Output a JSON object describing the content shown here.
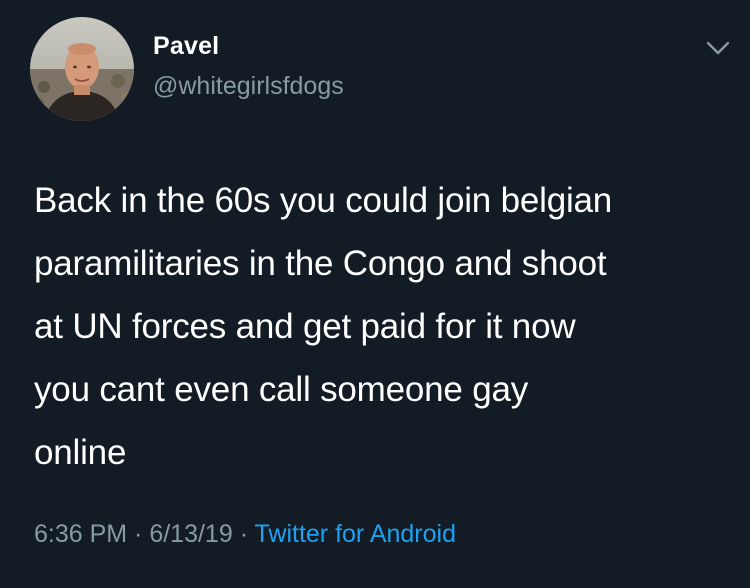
{
  "user": {
    "display_name": "Pavel",
    "handle": "@whitegirlsfdogs",
    "avatar_icon": "user-avatar-photo"
  },
  "menu": {
    "icon": "chevron-down-icon"
  },
  "tweet": {
    "text": "Back in the 60s you could join belgian\nparamilitaries in the Congo and shoot\nat UN forces and get paid for it now\nyou cant even call someone gay\nonline"
  },
  "meta": {
    "time": "6:36 PM",
    "separator1": " · ",
    "date": "6/13/19",
    "separator2": " · ",
    "source": "Twitter for Android"
  },
  "colors": {
    "background": "#131b24",
    "text": "#ffffff",
    "secondary": "#8899a6",
    "link": "#1da1f2"
  }
}
